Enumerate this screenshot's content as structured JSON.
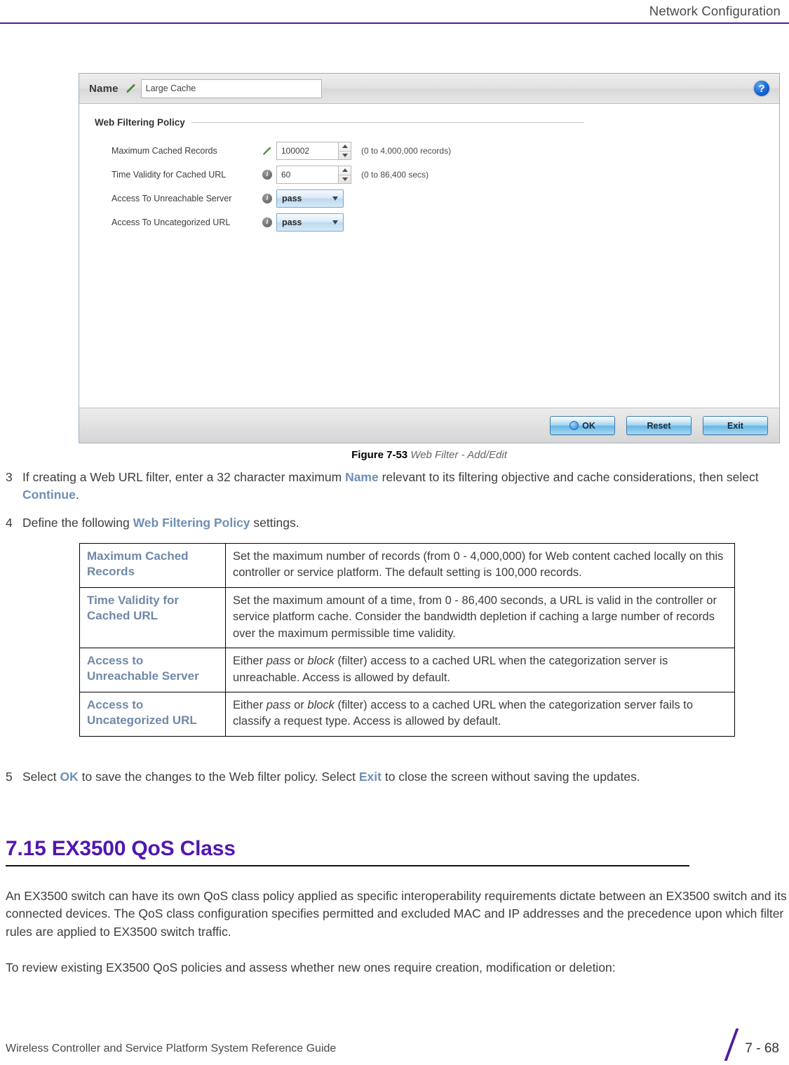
{
  "header": {
    "title": "Network Configuration"
  },
  "figure": {
    "caption_label": "Figure 7-53",
    "caption_text": "Web Filter - Add/Edit",
    "dialog": {
      "name_label": "Name",
      "name_value": "Large Cache",
      "name_pencil_icon": "pencil-icon",
      "help_icon": "help-icon",
      "help_glyph": "?",
      "section_title": "Web Filtering Policy",
      "fields": [
        {
          "label": "Maximum Cached Records",
          "icon": "pencil-icon",
          "type": "spinner",
          "value": "100002",
          "hint": "(0 to 4,000,000 records)"
        },
        {
          "label": "Time Validity for Cached URL",
          "icon": "info-icon",
          "type": "spinner",
          "value": "60",
          "hint": "(0 to 86,400 secs)"
        },
        {
          "label": "Access To Unreachable Server",
          "icon": "info-icon",
          "type": "dropdown",
          "value": "pass",
          "hint": ""
        },
        {
          "label": "Access To Uncategorized URL",
          "icon": "info-icon",
          "type": "dropdown",
          "value": "pass",
          "hint": ""
        }
      ],
      "buttons": [
        {
          "label": "OK",
          "glyph": true
        },
        {
          "label": "Reset",
          "glyph": false
        },
        {
          "label": "Exit",
          "glyph": false
        }
      ]
    }
  },
  "steps": {
    "step3": {
      "num": "3",
      "part1": "If creating a Web URL filter, enter a 32 character maximum ",
      "kw1": "Name",
      "part2": " relevant to its filtering objective and cache considerations, then select ",
      "kw2": "Continue",
      "part3": "."
    },
    "step4": {
      "num": "4",
      "part1": "Define the following ",
      "kw1": "Web Filtering Policy",
      "part2": " settings."
    },
    "step5": {
      "num": "5",
      "part1": "Select ",
      "kw1": "OK",
      "part2": " to save the changes to the Web filter policy. Select ",
      "kw2": "Exit",
      "part3": " to close the screen without saving the updates."
    }
  },
  "param_table": {
    "rows": [
      {
        "label": "Maximum Cached Records",
        "desc_pre": "Set the maximum number of records (from 0 - 4,000,000) for Web content cached locally on this controller or service platform. The default setting is 100,000 records.",
        "em1": "",
        "desc_mid": "",
        "em2": "",
        "desc_post": ""
      },
      {
        "label": "Time Validity for Cached URL",
        "desc_pre": "Set the maximum amount of a time, from 0 - 86,400 seconds, a URL is valid in the controller or service platform cache. Consider the bandwidth depletion if caching a large number of records over the maximum permissible time validity.",
        "em1": "",
        "desc_mid": "",
        "em2": "",
        "desc_post": ""
      },
      {
        "label": "Access to Unreachable Server",
        "desc_pre": "Either ",
        "em1": "pass",
        "desc_mid": " or ",
        "em2": "block",
        "desc_post": " (filter) access to a cached URL when the categorization server is unreachable. Access is allowed by default."
      },
      {
        "label": "Access to Uncategorized URL",
        "desc_pre": "Either ",
        "em1": "pass",
        "desc_mid": " or ",
        "em2": "block",
        "desc_post": " (filter) access to a cached URL when the categorization server fails to classify a request type. Access is allowed by default."
      }
    ]
  },
  "section": {
    "heading": "7.15 EX3500 QoS Class",
    "para1": "An EX3500 switch can have its own QoS class policy applied as specific interoperability requirements dictate between an EX3500 switch and its connected devices. The QoS class configuration specifies permitted and excluded MAC and IP addresses and the precedence upon which filter rules are applied to EX3500 switch traffic.",
    "para2": "To review existing EX3500 QoS policies and assess whether new ones require creation, modification or deletion:"
  },
  "footer": {
    "guide": "Wireless Controller and Service Platform System Reference Guide",
    "page": "7 - 68"
  },
  "colors": {
    "accent_purple": "#5216b0",
    "rule_purple": "#4a1f9e",
    "keyword_blue": "#6e8fb5",
    "table_label": "#7089a8"
  }
}
